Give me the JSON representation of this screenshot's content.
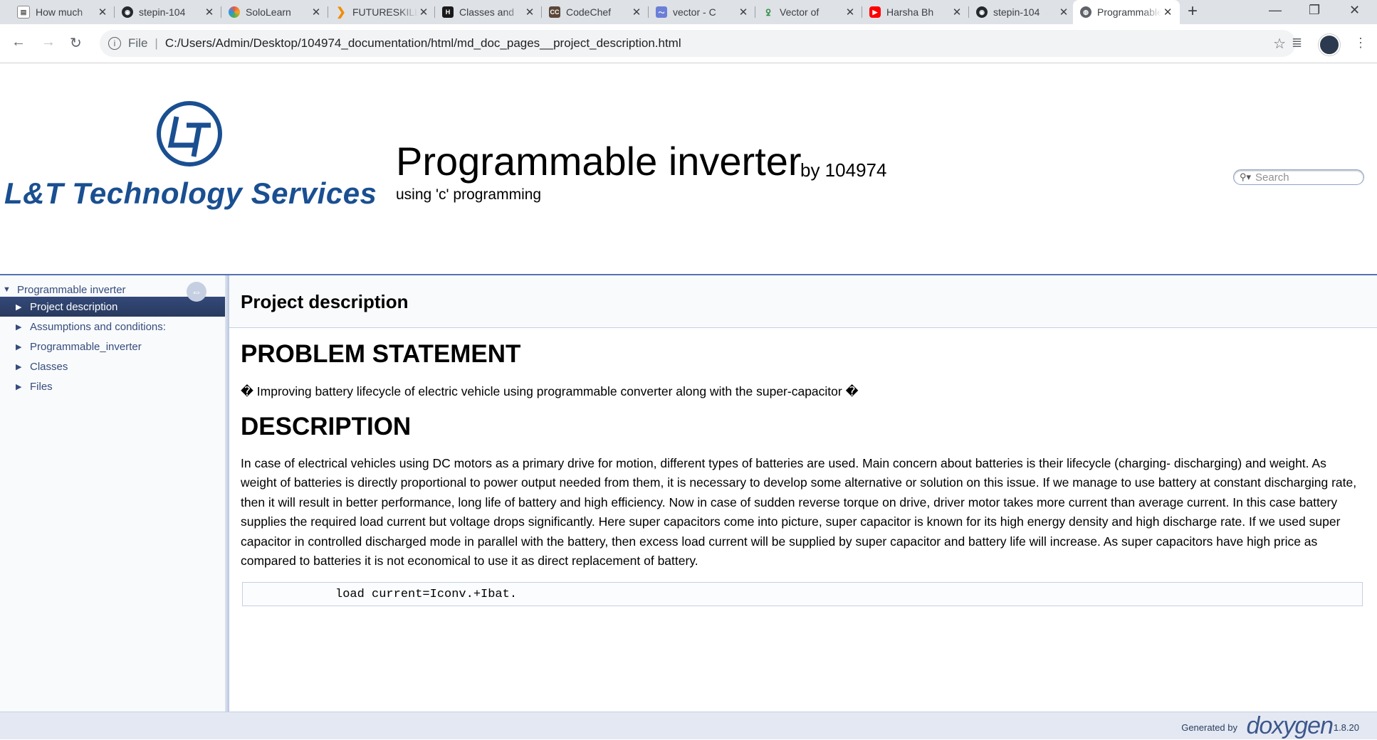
{
  "browser": {
    "tabs": [
      {
        "title": "How much",
        "favicon": "page-icon",
        "color": "#8a8a8a"
      },
      {
        "title": "stepin-104",
        "favicon": "github-icon",
        "color": "#24292e"
      },
      {
        "title": "SoloLearn",
        "favicon": "sololearn-icon",
        "color": "#e8594a"
      },
      {
        "title": "FUTURESKILLS",
        "favicon": "futureskills-icon",
        "color": "#f28c00"
      },
      {
        "title": "Classes and",
        "favicon": "geeksforgeeks-icon",
        "color": "#1a1a1a"
      },
      {
        "title": "CodeChef",
        "favicon": "codechef-icon",
        "color": "#5b4638"
      },
      {
        "title": "vector - C",
        "favicon": "cppreference-icon",
        "color": "#6b7fd7"
      },
      {
        "title": "Vector of",
        "favicon": "geeks-icon",
        "color": "#2f8d46"
      },
      {
        "title": "Harsha Bh",
        "favicon": "youtube-icon",
        "color": "#ff0000"
      },
      {
        "title": "stepin-104",
        "favicon": "github-icon",
        "color": "#24292e"
      },
      {
        "title": "Programmable",
        "favicon": "globe-icon",
        "color": "#5f6368"
      }
    ],
    "active_tab_index": 10,
    "address": {
      "scheme_label": "File",
      "url": "C:/Users/Admin/Desktop/104974_documentation/html/md_doc_pages__project_description.html"
    }
  },
  "header": {
    "logo_text": "L&T Technology Services",
    "project_name": "Programmable inverter",
    "project_number": "by 104974",
    "project_brief": "using 'c' programming",
    "search_placeholder": "Search"
  },
  "nav_tree": {
    "root": "Programmable inverter",
    "items": [
      {
        "label": "Project description",
        "selected": true
      },
      {
        "label": "Assumptions and conditions:",
        "selected": false
      },
      {
        "label": "Programmable_inverter",
        "selected": false
      },
      {
        "label": "Classes",
        "selected": false
      },
      {
        "label": "Files",
        "selected": false
      }
    ]
  },
  "content": {
    "page_title": "Project description",
    "sections": [
      {
        "heading": "PROBLEM STATEMENT",
        "text": "� Improving battery lifecycle of electric vehicle using programmable converter along with the super-capacitor �"
      },
      {
        "heading": "DESCRIPTION",
        "text": "In case of electrical vehicles using DC motors as a primary drive for motion, different types of batteries are used. Main concern about batteries is their lifecycle (charging- discharging) and weight. As weight of batteries is directly proportional to power output needed from them, it is necessary to develop some alternative or solution on this issue. If we manage to use battery at constant discharging rate, then it will result in better performance, long life of battery and high efficiency. Now in case of sudden reverse torque on drive, driver motor takes more current than average current. In this case battery supplies the required load current but voltage drops significantly. Here super capacitors come into picture, super capacitor is known for its high energy density and high discharge rate. If we used super capacitor in controlled discharged mode in parallel with the battery, then excess load current will be supplied by super capacitor and battery life will increase. As super capacitors have high price as compared to batteries it is not economical to use it as direct replacement of battery."
      }
    ],
    "code": "load current=Iconv.+Ibat."
  },
  "footer": {
    "generated_by": "Generated by",
    "tool": "doxygen",
    "version": "1.8.20"
  }
}
